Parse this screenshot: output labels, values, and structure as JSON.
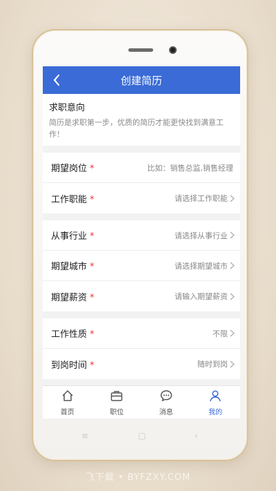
{
  "header": {
    "title": "创建简历"
  },
  "intro": {
    "heading": "求职意向",
    "desc": "简历是求职第一步，优质的简历才能更快找到满意工作！"
  },
  "groups": [
    [
      {
        "label": "期望岗位",
        "value": "比如：销售总监,销售经理",
        "arrow": false
      },
      {
        "label": "工作职能",
        "value": "请选择工作职能",
        "arrow": true
      }
    ],
    [
      {
        "label": "从事行业",
        "value": "请选择从事行业",
        "arrow": true
      },
      {
        "label": "期望城市",
        "value": "请选择期望城市",
        "arrow": true
      },
      {
        "label": "期望薪资",
        "value": "请输入期望薪资",
        "arrow": true
      }
    ],
    [
      {
        "label": "工作性质",
        "value": "不限",
        "arrow": true
      },
      {
        "label": "到岗时间",
        "value": "随时到岗",
        "arrow": true
      }
    ]
  ],
  "required_mark": "*",
  "tabbar": {
    "items": [
      {
        "label": "首页",
        "icon": "home-icon"
      },
      {
        "label": "职位",
        "icon": "briefcase-icon"
      },
      {
        "label": "消息",
        "icon": "chat-icon"
      },
      {
        "label": "我的",
        "icon": "user-icon"
      }
    ],
    "active_index": 3
  },
  "system_nav": {
    "menu": "≡",
    "home": "▢",
    "back": "‹"
  },
  "watermark": "飞下载 • BYFZXY.COM",
  "colors": {
    "accent": "#3a6bd6",
    "required": "#ee3333"
  }
}
